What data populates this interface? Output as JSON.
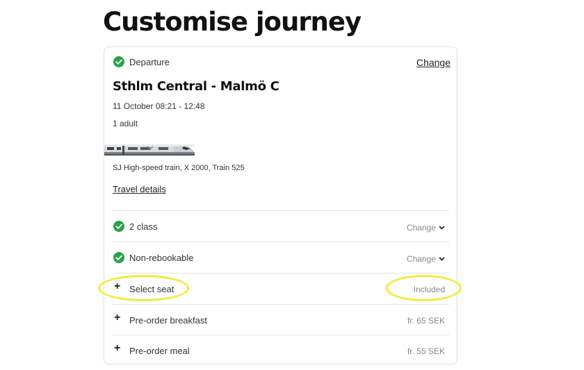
{
  "page_title": "Customise journey",
  "departure": {
    "label": "Departure",
    "change_label": "Change",
    "route": "Sthlm Central - Malmö C",
    "datetime": "11 October 08:21 - 12:48",
    "passengers": "1 adult",
    "train_info": "SJ High-speed train, X 2000, Train 525",
    "travel_details_label": "Travel details"
  },
  "options": [
    {
      "icon": "check-icon",
      "label": "2 class",
      "action": "Change",
      "status": "selected"
    },
    {
      "icon": "check-icon",
      "label": "Non-rebookable",
      "action": "Change",
      "status": "selected"
    },
    {
      "icon": "plus-icon",
      "label": "Select seat",
      "price": "Included"
    },
    {
      "icon": "plus-icon",
      "label": "Pre-order breakfast",
      "price": "fr. 65 SEK"
    },
    {
      "icon": "plus-icon",
      "label": "Pre-order meal",
      "price": "fr. 55 SEK"
    }
  ],
  "colors": {
    "check_green": "#2aa24a",
    "highlight_yellow": "#f0ec3a",
    "muted_text": "#888888"
  }
}
